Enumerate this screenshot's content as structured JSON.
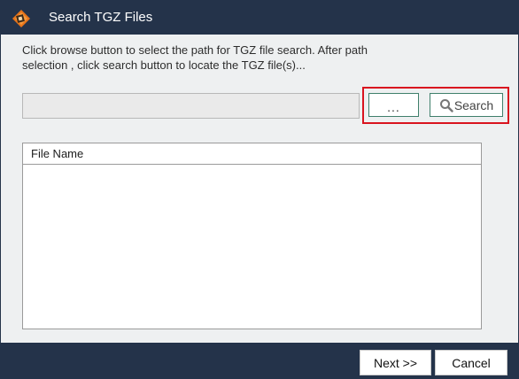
{
  "window": {
    "title": "Search TGZ Files",
    "app_icon": "tgz-app-icon"
  },
  "instructions": "Click browse button to select the path for TGZ file search. After path selection , click search button to locate the TGZ file(s)...",
  "search": {
    "path_value": "",
    "browse_label": "...",
    "search_label": "Search",
    "search_icon": "magnifier-icon"
  },
  "file_list": {
    "columns": [
      "File Name"
    ],
    "rows": []
  },
  "footer": {
    "next_label": "Next >>",
    "cancel_label": "Cancel"
  },
  "colors": {
    "titlebar": "#24334a",
    "body": "#eef0f1",
    "highlight": "#d9141f",
    "button_border": "#3f7f6b"
  }
}
